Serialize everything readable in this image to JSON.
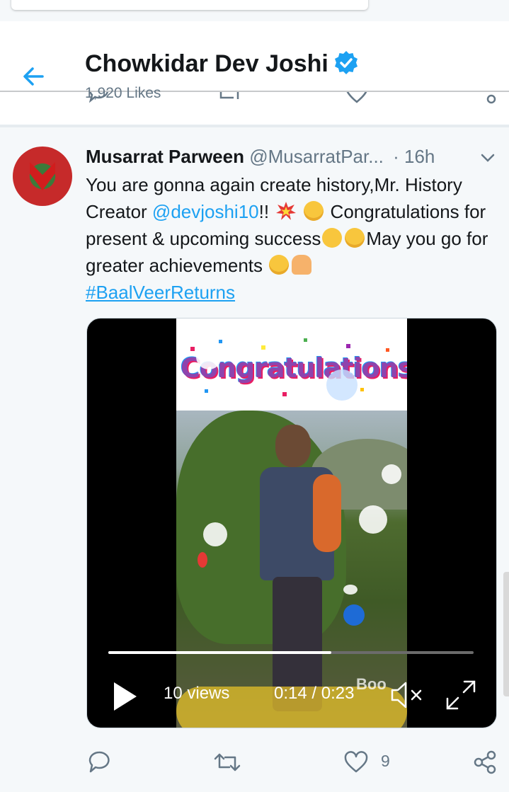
{
  "header": {
    "title": "Chowkidar Dev Joshi",
    "likes": "1,920 Likes",
    "accent": "#1da1f2"
  },
  "tweet": {
    "name": "Musarrat Parween",
    "handle": "@MusarratPar...",
    "time": "· 16h",
    "text_1": "You are gonna again create history,Mr. History Creator ",
    "mention": "@devjoshi10",
    "text_2": "!! ",
    "text_3": " Congratulations for present & upcoming success",
    "text_4": "May you go for greater achievements ",
    "hashtag": "#BaalVeerReturns",
    "emoji": [
      "collision",
      "smiling-face-with-halo",
      "star-struck",
      "smiling-face-with-halo",
      "smiling-face-with-halo",
      "woman-tipping-hand"
    ]
  },
  "video": {
    "overlay_text": "Congratulations!",
    "watermark": "Boo",
    "views": "10 views",
    "time": "0:14 / 0:23",
    "progress": 0.61,
    "muted": true
  },
  "actions": {
    "like_count": "9"
  }
}
